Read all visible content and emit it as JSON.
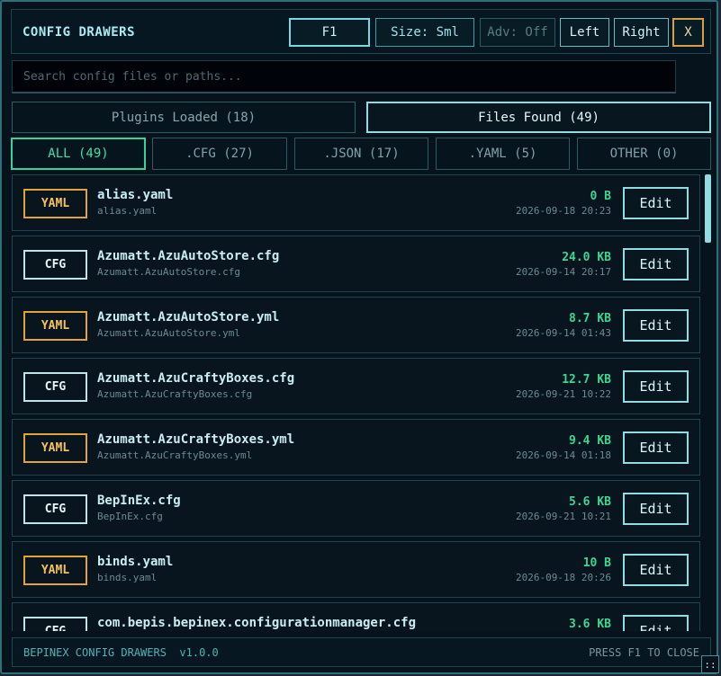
{
  "header": {
    "title": "CONFIG DRAWERS",
    "hotkey": "F1",
    "size": "Size: Sml",
    "adv": "Adv: Off",
    "left": "Left",
    "right": "Right",
    "close": "X"
  },
  "search": {
    "placeholder": "Search config files or paths..."
  },
  "tabs": {
    "plugins": "Plugins Loaded (18)",
    "files": "Files Found (49)"
  },
  "filters": {
    "all": "ALL (49)",
    "cfg": ".CFG (27)",
    "json": ".JSON (17)",
    "yaml": ".YAML (5)",
    "other": "OTHER (0)"
  },
  "files": [
    {
      "type": "YAML",
      "name": "alias.yaml",
      "path": "alias.yaml",
      "size": "0 B",
      "date": "2026-09-18 20:23",
      "edit": "Edit"
    },
    {
      "type": "CFG",
      "name": "Azumatt.AzuAutoStore.cfg",
      "path": "Azumatt.AzuAutoStore.cfg",
      "size": "24.0 KB",
      "date": "2026-09-14 20:17",
      "edit": "Edit"
    },
    {
      "type": "YAML",
      "name": "Azumatt.AzuAutoStore.yml",
      "path": "Azumatt.AzuAutoStore.yml",
      "size": "8.7 KB",
      "date": "2026-09-14 01:43",
      "edit": "Edit"
    },
    {
      "type": "CFG",
      "name": "Azumatt.AzuCraftyBoxes.cfg",
      "path": "Azumatt.AzuCraftyBoxes.cfg",
      "size": "12.7 KB",
      "date": "2026-09-21 10:22",
      "edit": "Edit"
    },
    {
      "type": "YAML",
      "name": "Azumatt.AzuCraftyBoxes.yml",
      "path": "Azumatt.AzuCraftyBoxes.yml",
      "size": "9.4 KB",
      "date": "2026-09-14 01:18",
      "edit": "Edit"
    },
    {
      "type": "CFG",
      "name": "BepInEx.cfg",
      "path": "BepInEx.cfg",
      "size": "5.6 KB",
      "date": "2026-09-21 10:21",
      "edit": "Edit"
    },
    {
      "type": "YAML",
      "name": "binds.yaml",
      "path": "binds.yaml",
      "size": "10 B",
      "date": "2026-09-18 20:26",
      "edit": "Edit"
    },
    {
      "type": "CFG",
      "name": "com.bepis.bepinex.configurationmanager.cfg",
      "path": "",
      "size": "3.6 KB",
      "date": "",
      "edit": "Edit"
    }
  ],
  "footer": {
    "left": "BEPINEX CONFIG DRAWERS  v1.0.0",
    "right": "PRESS F1 TO CLOSE",
    "resize": "::"
  }
}
